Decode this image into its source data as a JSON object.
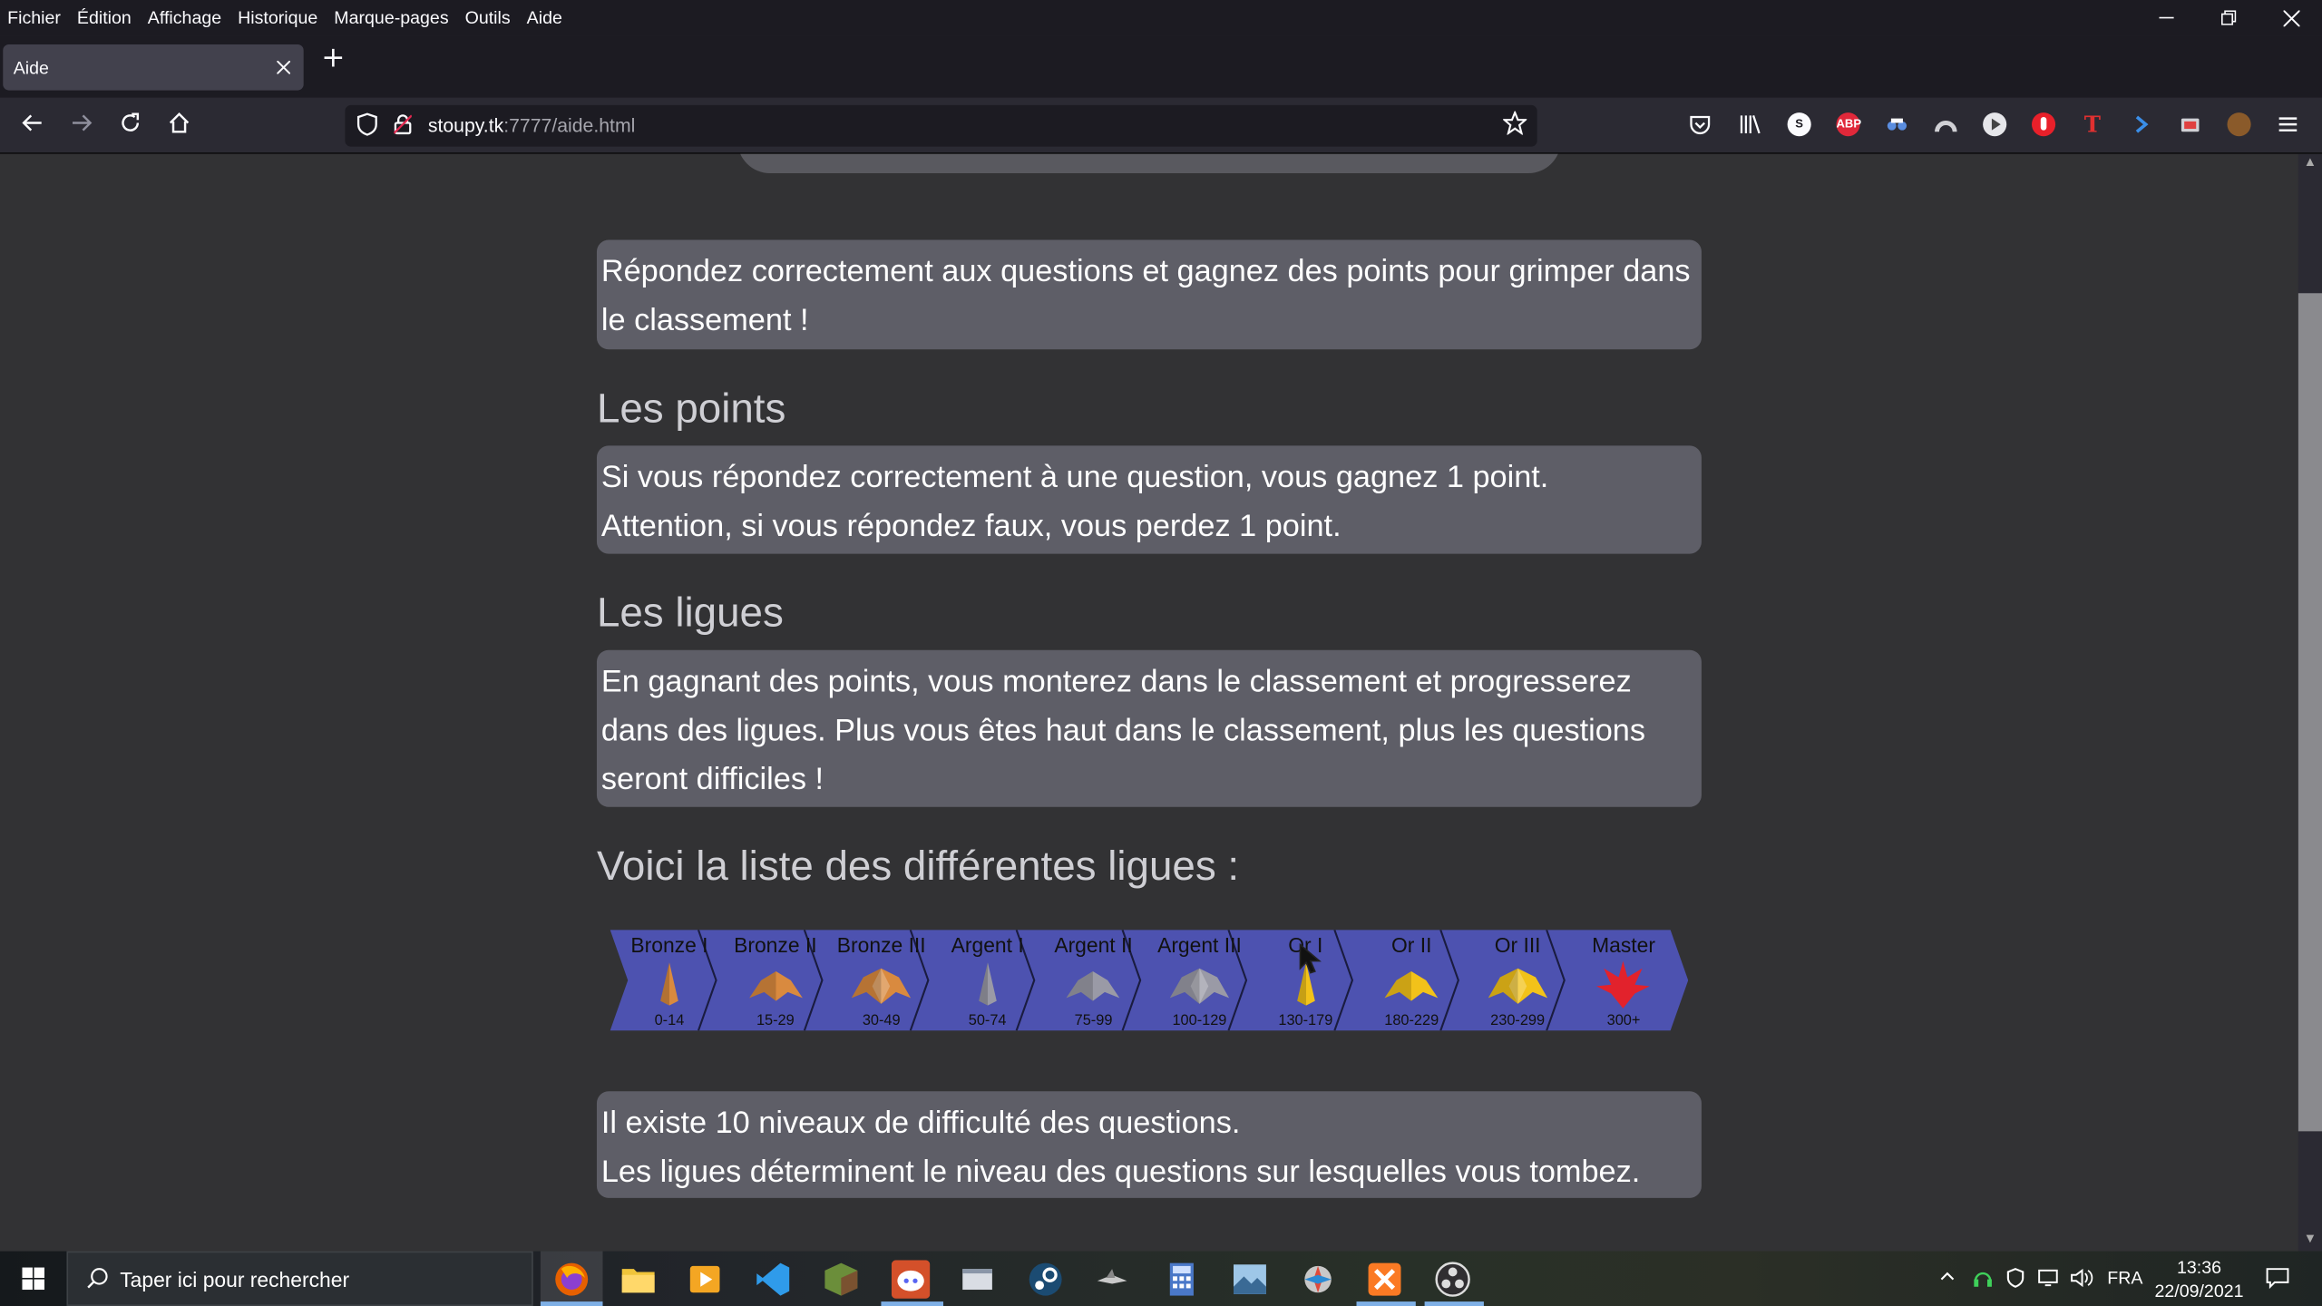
{
  "menu": {
    "items": [
      "Fichier",
      "Édition",
      "Affichage",
      "Historique",
      "Marque-pages",
      "Outils",
      "Aide"
    ]
  },
  "window": {
    "minimize_icon": "minimize-icon",
    "restore_icon": "restore-icon",
    "close_icon": "close-icon"
  },
  "tab": {
    "title": "Aide",
    "close_icon": "close-icon",
    "new_tab_icon": "plus-icon"
  },
  "nav": {
    "url_host": "stoupy.tk",
    "url_rest": ":7777/aide.html"
  },
  "page": {
    "intro": "Répondez correctement aux questions et gagnez des points pour grimper dans le classement !",
    "points_heading": "Les points",
    "points_line1": "Si vous répondez correctement à une question, vous gagnez 1 point.",
    "points_line2": "Attention, si vous répondez faux, vous perdez 1 point.",
    "leagues_heading": "Les ligues",
    "leagues_text": "En gagnant des points, vous monterez dans le classement et progresserez dans des ligues. Plus vous êtes haut dans le classement, plus les questions seront difficiles !",
    "list_heading": "Voici la liste des différentes ligues :",
    "difficulty_line1": "Il existe 10 niveaux de difficulté des questions.",
    "difficulty_line2": "Les ligues déterminent le niveau des questions sur lesquelles vous tombez."
  },
  "leagues": [
    {
      "name": "Bronze I",
      "range": "0-14",
      "color": "#d98a3f",
      "icon": "bronze-1-icon"
    },
    {
      "name": "Bronze II",
      "range": "15-29",
      "color": "#d98a3f",
      "icon": "bronze-2-icon"
    },
    {
      "name": "Bronze III",
      "range": "30-49",
      "color": "#d98a3f",
      "icon": "bronze-3-icon"
    },
    {
      "name": "Argent I",
      "range": "50-74",
      "color": "#9a9aa6",
      "icon": "silver-1-icon"
    },
    {
      "name": "Argent II",
      "range": "75-99",
      "color": "#9a9aa6",
      "icon": "silver-2-icon"
    },
    {
      "name": "Argent III",
      "range": "100-129",
      "color": "#9a9aa6",
      "icon": "silver-3-icon"
    },
    {
      "name": "Or I",
      "range": "130-179",
      "color": "#f2c21a",
      "icon": "gold-1-icon"
    },
    {
      "name": "Or II",
      "range": "180-229",
      "color": "#f2c21a",
      "icon": "gold-2-icon"
    },
    {
      "name": "Or III",
      "range": "230-299",
      "color": "#f2c21a",
      "icon": "gold-3-icon"
    },
    {
      "name": "Master",
      "range": "300+",
      "color": "#e2222c",
      "icon": "master-icon"
    }
  ],
  "taskbar": {
    "search_placeholder": "Taper ici pour rechercher",
    "language": "FRA",
    "time": "13:36",
    "date": "22/09/2021"
  },
  "colors": {
    "banner_blue": "#4d52b0",
    "card_bg": "#5e5e67",
    "page_bg": "#323234"
  }
}
